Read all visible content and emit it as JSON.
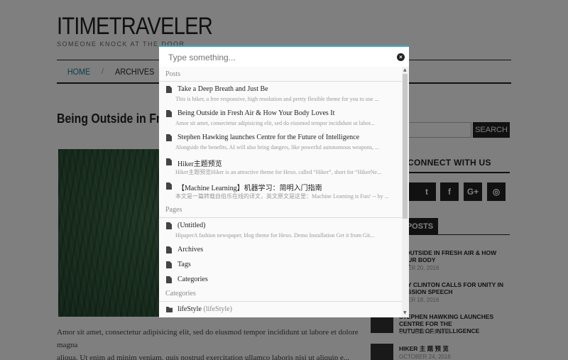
{
  "site": {
    "title": "ITIMETRAVELER",
    "subtitle": "SOMEONE KNOCK AT THE DOOR"
  },
  "nav": {
    "items": [
      "HOME",
      "ARCHIVES"
    ],
    "separator": "/"
  },
  "post": {
    "title": "Being Outside in Fre",
    "excerpt_line1": "Amor sit amet, consectetur adipisicing elit, sed do eiusmod tempor incididunt ut labore et dolore magna",
    "excerpt_line2": "aliqua. Ut enim ad minim veniam, quis nostrud exercitation ullamco laboris nisi ut aliquip e..."
  },
  "sidebar": {
    "search_button": "SEARCH",
    "connect_title": "CONNECT WITH US",
    "social_icons": [
      "twitter-icon",
      "facebook-icon",
      "google-plus-icon",
      "instagram-icon"
    ],
    "social_glyphs": [
      "t",
      "f",
      "G+",
      "◎"
    ],
    "posts_tab": "POSTS",
    "recent_posts": [
      {
        "title_line1": "G OUTSIDE IN FRESH AIR & HOW YOUR BODY",
        "title_line2": "S IT",
        "date": "MBER 20, 2016"
      },
      {
        "title_line1": "ARY CLINTON CALLS FOR UNITY IN",
        "title_line2": "CESSION SPEECH",
        "date": "MBER 18, 2016"
      },
      {
        "title_line1": "STEPHEN HAWKING LAUNCHES CENTRE FOR THE",
        "title_line2": "FUTURE OF INTELLIGENCE",
        "date": "OCTOBER 26, 2016"
      },
      {
        "title_line1": "HIKER 主 题 预 览",
        "title_line2": "",
        "date": "OCTOBER 24, 2016"
      }
    ]
  },
  "search_modal": {
    "placeholder": "Type something...",
    "close_glyph": "×",
    "sections": {
      "posts": "Posts",
      "pages": "Pages",
      "categories": "Categories"
    },
    "posts": [
      {
        "title": "Take a Deep Breath and Just Be",
        "desc": "This is hiker, a free responsive, high resolution and pretty flexible theme for you to use ..."
      },
      {
        "title": "Being Outside in Fresh Air & How Your Body Loves It",
        "desc": "Amor sit amet, consectetur adipisicing elit, sed do eiusmod tempor incididunt ut labor..."
      },
      {
        "title": "Stephen Hawking launches Centre for the Future of Intelligence",
        "desc": "Alongside the benefits, AI will also bring dangers, like powerful autonomous weapons, ..."
      },
      {
        "title": "Hiker主题预览",
        "desc": "Hiker主题预览Hiker is an attractive theme for Hexo. called “Hiker”, short for “HikerNe..."
      },
      {
        "title": "【Machine Learning】机器学习：简明入门指南",
        "desc": "本文是一篇转载自伯乐在线的译文，英文原文是这里：Machine Learning is Fun! -- by ..."
      }
    ],
    "pages": [
      {
        "title": "(Untitled)",
        "desc": "HipaperA fashion newspaper, blog theme for Hexo. Demo Installation Get it from Git..."
      },
      {
        "title": "Archives"
      },
      {
        "title": "Tags"
      },
      {
        "title": "Categories"
      }
    ],
    "categories": [
      {
        "title": "lifeStyle",
        "extra": "(lifeStyle)"
      }
    ],
    "accent_color": "#3aa9c6"
  }
}
